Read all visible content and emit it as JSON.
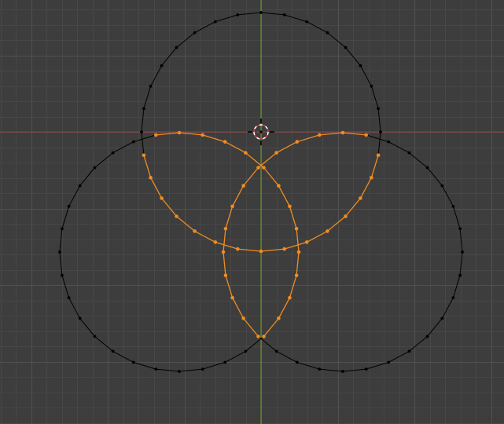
{
  "viewport": {
    "background": "#3d3d3d",
    "grid_minor_color": "#474747",
    "grid_major_color": "#515151",
    "x_axis_color": "#a33b3b",
    "y_axis_color": "#6e9e2a"
  },
  "mesh": {
    "unselected_color": "#000000",
    "selected_color": "#f08c22",
    "circles": [
      {
        "name": "top",
        "vertex_count": 32
      },
      {
        "name": "left",
        "vertex_count": 32
      },
      {
        "name": "right",
        "vertex_count": 32
      }
    ]
  },
  "cursor": {
    "icon": "3d-cursor-icon",
    "ring_color": "#ffffff",
    "dash_color": "#d43b3b"
  }
}
